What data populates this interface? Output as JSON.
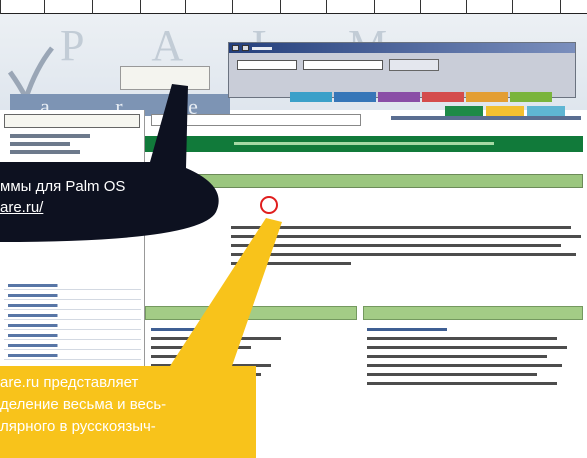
{
  "colors": {
    "dark_callout": "#0d1120",
    "yellow_callout": "#f8c31b",
    "green_banner": "#117a3a",
    "section_bar": "#9bc67f",
    "marker": "#e01e1e"
  },
  "callouts": {
    "dark": {
      "line1": "ммы для Palm OS",
      "line2": "are.ru/"
    },
    "yellow": {
      "line1": "are.ru    представляет",
      "line2": "деление весьма и весь-",
      "line3": "лярного  в  русскоязыч-"
    }
  },
  "icons": {
    "logo": "palmware-check-logo",
    "marker": "red-circle-marker"
  }
}
